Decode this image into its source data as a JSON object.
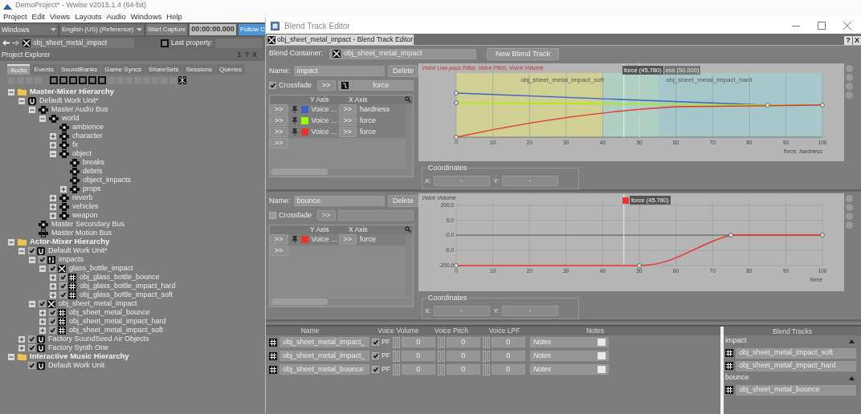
{
  "app": {
    "title": "DemoProject* - Wwise v2015.1.4 (64-bit)",
    "menu": [
      "Project",
      "Edit",
      "Views",
      "Layouts",
      "Audio",
      "Windows",
      "Help"
    ],
    "toolbar": {
      "layout": "Windows",
      "language": "English (US) (Reference)",
      "capture_button": "Start Capture",
      "time": "00:00:00.000",
      "follow_button": "Follow C"
    },
    "nav": {
      "object": "obj_sheet_metal_impact",
      "last_property": "Last property:"
    }
  },
  "explorer": {
    "title": "Project Explorer",
    "header_buttons": [
      "1",
      "?",
      "X"
    ],
    "tabs": [
      {
        "label": "Audio",
        "selected": true
      },
      {
        "label": "Events",
        "selected": false
      },
      {
        "label": "SoundBanks",
        "selected": false
      },
      {
        "label": "Game Syncs",
        "selected": false
      },
      {
        "label": "ShareSets",
        "selected": false
      },
      {
        "label": "Sessions",
        "selected": false
      },
      {
        "label": "Queries",
        "selected": false
      }
    ],
    "tree": [
      {
        "label": "Master-Mixer Hierarchy",
        "kind": "folder",
        "expanded": true,
        "children": [
          {
            "label": "Default Work Unit*",
            "kind": "workunit",
            "expanded": true,
            "children": [
              {
                "label": "Master Audio Bus",
                "kind": "bus",
                "expanded": true,
                "children": [
                  {
                    "label": "world",
                    "kind": "bus",
                    "expanded": true,
                    "children": [
                      {
                        "label": "ambience",
                        "kind": "bus"
                      },
                      {
                        "label": "character",
                        "kind": "bus",
                        "expanded": false
                      },
                      {
                        "label": "fx",
                        "kind": "bus",
                        "expanded": false
                      },
                      {
                        "label": "object",
                        "kind": "bus",
                        "expanded": true,
                        "children": [
                          {
                            "label": "breaks",
                            "kind": "bus"
                          },
                          {
                            "label": "debris",
                            "kind": "bus"
                          },
                          {
                            "label": "object_impacts",
                            "kind": "bus"
                          },
                          {
                            "label": "props",
                            "kind": "bus",
                            "expanded": false
                          }
                        ]
                      },
                      {
                        "label": "reverb",
                        "kind": "bus",
                        "expanded": false
                      },
                      {
                        "label": "vehicles",
                        "kind": "bus",
                        "expanded": false
                      },
                      {
                        "label": "weapon",
                        "kind": "bus",
                        "expanded": false
                      }
                    ]
                  }
                ]
              },
              {
                "label": "Master Secondary Bus",
                "kind": "bus"
              },
              {
                "label": "Master Motion Bus",
                "kind": "motion_bus"
              }
            ]
          }
        ]
      },
      {
        "label": "Actor-Mixer Hierarchy",
        "kind": "folder",
        "expanded": true,
        "children": [
          {
            "label": "Default Work Unit*",
            "kind": "workunit",
            "checked": true,
            "expanded": true,
            "children": [
              {
                "label": "impacts",
                "kind": "actor_mixer",
                "checked": true,
                "expanded": true,
                "children": [
                  {
                    "label": "glass_bottle_impact",
                    "kind": "blend",
                    "checked": true,
                    "expanded": true,
                    "children": [
                      {
                        "label": "obj_glass_bottle_bounce",
                        "kind": "sound",
                        "checked": true,
                        "expanded": false
                      },
                      {
                        "label": "obj_glass_bottle_impact_hard",
                        "kind": "sound",
                        "checked": true,
                        "expanded": false
                      },
                      {
                        "label": "obj_glass_bottle_impact_soft",
                        "kind": "sound",
                        "checked": true,
                        "expanded": false
                      }
                    ]
                  }
                ]
              },
              {
                "label": "obj_sheet_metal_impact",
                "kind": "blend",
                "checked": true,
                "expanded": true,
                "children": [
                  {
                    "label": "obj_sheet_metal_bounce",
                    "kind": "sound",
                    "checked": true,
                    "expanded": false
                  },
                  {
                    "label": "obj_sheet_metal_impact_hard",
                    "kind": "sound",
                    "checked": true,
                    "expanded": false
                  },
                  {
                    "label": "obj_sheet_metal_impact_soft",
                    "kind": "sound",
                    "checked": true,
                    "expanded": false
                  }
                ]
              }
            ]
          },
          {
            "label": "Factory SoundSeed Air Objects",
            "kind": "workunit",
            "checked": true,
            "expanded": false
          },
          {
            "label": "Factory Synth One",
            "kind": "workunit",
            "checked": true,
            "expanded": false
          }
        ]
      },
      {
        "label": "Interactive Music Hierarchy",
        "kind": "folder",
        "expanded": true,
        "children": [
          {
            "label": "Default Work Unit",
            "kind": "workunit",
            "checked": true
          }
        ]
      }
    ]
  },
  "editor": {
    "window_title": "Blend Track Editor",
    "tab": "obj_sheet_metal_impact - Blend Track Editor",
    "tab_buttons": [
      "?",
      "X"
    ],
    "container_label": "Blend Container:",
    "container": "obj_sheet_metal_impact",
    "new_button": "New Blend Track",
    "tracks": [
      {
        "name_label": "Name:",
        "name": "impact",
        "delete_button": "Delete",
        "crossfade": {
          "label": "Crossfade",
          "checked": true,
          "button": ">>",
          "parameter": "force"
        },
        "columns": [
          "Y Axis",
          "X Axis"
        ],
        "rows": [
          {
            "button": ">>",
            "color": "#3f62c4",
            "y": "Voice ...",
            "x_button": ">>",
            "x": "hardness"
          },
          {
            "button": ">>",
            "color": "#99ff00",
            "y": "Voice ...",
            "x_button": ">>",
            "x": "force"
          },
          {
            "button": ">>",
            "color": "#e8322e",
            "y": "Voice ...",
            "x_button": ">>",
            "x": "force"
          }
        ],
        "add_button": ">>",
        "graph": {
          "kind": "crossfade",
          "title": "Voice Low-pass Filter, Voice Pitch, Voice Volume",
          "regions": [
            "obj_sheet_metal_impact_soft",
            "obj_sheet_metal_impact_hard"
          ],
          "cursors": [
            "force (45.780)",
            "ess (50.000)"
          ],
          "xticks": [
            "0",
            "10",
            "20",
            "30",
            "40",
            "50",
            "60",
            "70",
            "80",
            "90",
            "100"
          ],
          "xlabel": "force, hardness"
        },
        "coordinates": {
          "title": "Coordinates",
          "x_label": "X:",
          "x_value": "-",
          "y_label": "Y:",
          "y_value": "-"
        }
      },
      {
        "name_label": "Name:",
        "name": "bounce",
        "delete_button": "Delete",
        "crossfade": {
          "label": "Crossfade",
          "checked": false,
          "button": ">>"
        },
        "columns": [
          "Y Axis",
          "X Axis"
        ],
        "rows": [
          {
            "button": ">>",
            "color": "#e8322e",
            "y": "Voice ...",
            "x_button": ">>",
            "x": "force"
          }
        ],
        "add_button": ">>",
        "graph": {
          "kind": "curve",
          "title": "Voice Volume",
          "cursors": [
            "force (45.780)"
          ],
          "yticks": [
            "200.0",
            "6.0",
            "-0.0",
            "-6.0",
            "-200.0"
          ],
          "xticks": [
            "0",
            "10",
            "20",
            "30",
            "40",
            "50",
            "60",
            "70",
            "80",
            "90",
            "100"
          ],
          "xlabel": "force"
        },
        "coordinates": {
          "title": "Coordinates",
          "x_label": "X:",
          "x_value": "-",
          "y_label": "Y:",
          "y_value": "-"
        }
      }
    ]
  },
  "table": {
    "columns": [
      "Name",
      "Voice Volume",
      "Voice Pitch",
      "Voice LPF",
      "Notes"
    ],
    "rows": [
      {
        "name": "obj_sheet_metal_impact_",
        "pf_checked": true,
        "pf": "PF",
        "volume": "0",
        "pitch": "0",
        "lpf": "0",
        "notes_placeholder": "Notes"
      },
      {
        "name": "obj_sheet_metal_impact_",
        "pf_checked": true,
        "pf": "PF",
        "volume": "0",
        "pitch": "0",
        "lpf": "0",
        "notes_placeholder": "Notes"
      },
      {
        "name": "obj_sheet_metal_bounce",
        "pf_checked": true,
        "pf": "PF",
        "volume": "0",
        "pitch": "0",
        "lpf": "0",
        "notes_placeholder": "Notes"
      }
    ]
  },
  "blend_tracks": {
    "title": "Blend Tracks",
    "groups": [
      {
        "name": "impact",
        "expanded": true,
        "items": [
          "obj_sheet_metal_impact_soft",
          "obj_sheet_metal_impact_hard"
        ]
      },
      {
        "name": "bounce",
        "expanded": true,
        "items": [
          "obj_sheet_metal_bounce"
        ]
      }
    ]
  }
}
